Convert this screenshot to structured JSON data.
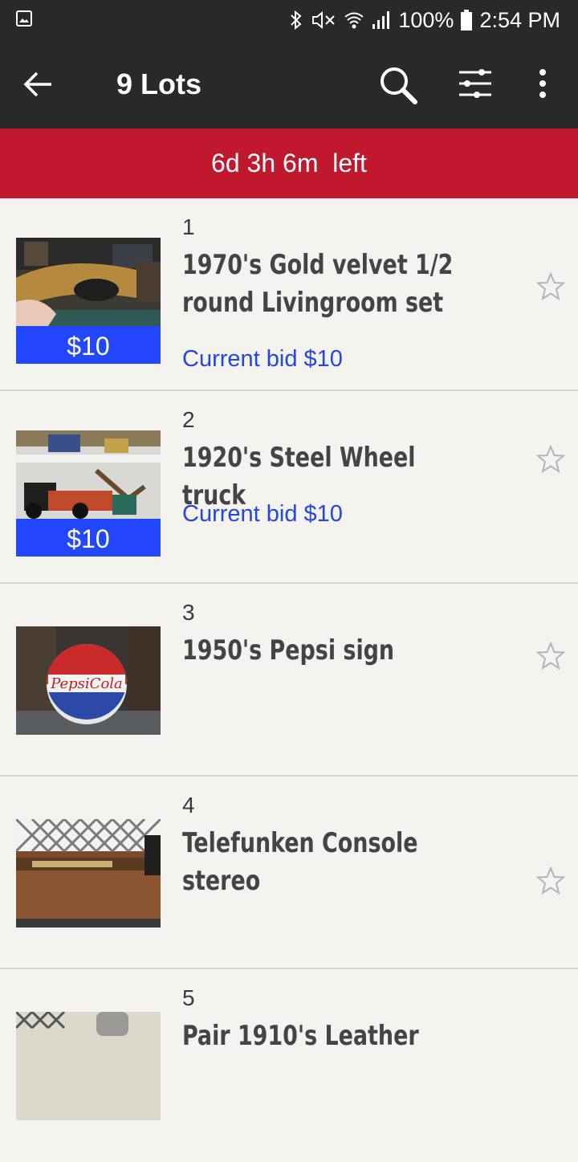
{
  "status_bar": {
    "battery": "100%",
    "time": "2:54 PM"
  },
  "app_bar": {
    "title": "9 Lots"
  },
  "timer": {
    "text": "6d 3h 6m  left"
  },
  "lots": [
    {
      "number": "1",
      "title": "1970's Gold velvet 1/2 round Livingroom set",
      "price_badge": "$10",
      "current_bid": "Current bid $10"
    },
    {
      "number": "2",
      "title": "1920's Steel Wheel truck",
      "price_badge": "$10",
      "current_bid": "Current bid $10"
    },
    {
      "number": "3",
      "title": "1950's Pepsi sign"
    },
    {
      "number": "4",
      "title": "Telefunken Console stereo"
    },
    {
      "number": "5",
      "title": "Pair 1910's Leather"
    }
  ],
  "colors": {
    "toolbar": "#272a27",
    "timer_bar": "#c0192d",
    "bid_blue": "#2346e0",
    "badge_blue": "#2346ff"
  }
}
